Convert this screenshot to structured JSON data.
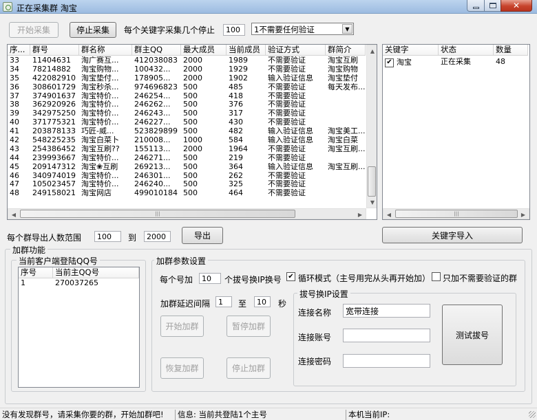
{
  "window": {
    "title": "正在采集群 淘宝"
  },
  "toolbar": {
    "start_collect": "开始采集",
    "stop_collect": "停止采集",
    "stop_after_label": "每个关键字采集几个停止",
    "stop_after_value": "100",
    "verify_select": "1不需要任何验证"
  },
  "groups_table": {
    "columns": [
      "序...",
      "群号",
      "群名称",
      "群主QQ",
      "最大成员",
      "当前成员",
      "验证方式",
      "群简介"
    ],
    "rows": [
      [
        "33",
        "11404631",
        "淘广赛互...",
        "412038083",
        "2000",
        "1989",
        "不需要验证",
        "淘宝互刷"
      ],
      [
        "34",
        "78214882",
        "淘宝购物...",
        "100432...",
        "2000",
        "1929",
        "不需要验证",
        "淘宝购物"
      ],
      [
        "35",
        "422082910",
        "淘宝垫付...",
        "178905...",
        "2000",
        "1902",
        "输入验证信息",
        "淘宝垫付"
      ],
      [
        "36",
        "308601729",
        "淘宝秒杀...",
        "974696823",
        "500",
        "485",
        "不需要验证",
        "每天发布..."
      ],
      [
        "37",
        "374901637",
        "淘宝特价...",
        "246254...",
        "500",
        "418",
        "不需要验证",
        ""
      ],
      [
        "38",
        "362920926",
        "淘宝特价...",
        "246262...",
        "500",
        "376",
        "不需要验证",
        ""
      ],
      [
        "39",
        "342975250",
        "淘宝特价...",
        "246243...",
        "500",
        "317",
        "不需要验证",
        ""
      ],
      [
        "40",
        "371775321",
        "淘宝特价...",
        "246227...",
        "500",
        "430",
        "不需要验证",
        ""
      ],
      [
        "41",
        "203878133",
        "巧匠-威...",
        "523829899",
        "500",
        "482",
        "输入验证信息",
        "淘宝美工..."
      ],
      [
        "42",
        "548225235",
        "淘宝白菜卜",
        "210008...",
        "1000",
        "584",
        "输入验证信息",
        "淘宝白菜"
      ],
      [
        "43",
        "254386452",
        "淘宝互刷??",
        "155113...",
        "2000",
        "1964",
        "不需要验证",
        "淘宝互刷..."
      ],
      [
        "44",
        "239993667",
        "淘宝特价...",
        "246271...",
        "500",
        "219",
        "不需要验证",
        ""
      ],
      [
        "45",
        "209147312",
        "淘宝❀互刷",
        "269213...",
        "500",
        "364",
        "输入验证信息",
        "淘宝互刷..."
      ],
      [
        "46",
        "340974019",
        "淘宝特价...",
        "246301...",
        "500",
        "262",
        "不需要验证",
        ""
      ],
      [
        "47",
        "105023457",
        "淘宝特价...",
        "246240...",
        "500",
        "325",
        "不需要验证",
        ""
      ],
      [
        "48",
        "249158021",
        "淘宝网店",
        "499010184",
        "500",
        "464",
        "不需要验证",
        ""
      ]
    ]
  },
  "keywords_table": {
    "columns": [
      "关键字",
      "状态",
      "数量"
    ],
    "rows": [
      {
        "keyword": "淘宝",
        "status": "正在采集",
        "count": "48",
        "checked": true
      }
    ]
  },
  "export": {
    "range_label": "每个群导出人数范围",
    "from_value": "100",
    "to_label": "到",
    "to_value": "2000",
    "export_button": "导出",
    "keyword_import_button": "关键字导入"
  },
  "join_section": {
    "title": "加群功能",
    "accounts_group_title": "当前客户端登陆QQ号",
    "accounts_columns": [
      "序号",
      "当前主QQ号"
    ],
    "accounts_rows": [
      [
        "1",
        "270037265"
      ]
    ]
  },
  "join_params": {
    "title": "加群参数设置",
    "per_number_label": "每个号加",
    "per_number_value": "10",
    "per_number_suffix": "个拔号换IP换号",
    "loop_mode_label": "循环模式（主号用完从头再开始加）",
    "loop_mode_checked": true,
    "only_no_verify_label": "只加不需要验证的群",
    "only_no_verify_checked": false,
    "delay_label": "加群延迟间隔",
    "delay_from": "1",
    "delay_to_label": "至",
    "delay_to": "10",
    "delay_unit": "秒",
    "start_join": "开始加群",
    "pause_join": "暂停加群",
    "resume_join": "恢复加群",
    "stop_join": "停止加群"
  },
  "dialup": {
    "title": "拔号换IP设置",
    "conn_name_label": "连接名称",
    "conn_name_value": "宽带连接",
    "account_label": "连接账号",
    "account_value": "",
    "password_label": "连接密码",
    "password_value": "",
    "test_button": "测试拔号"
  },
  "statusbar": {
    "left": "没有发现群号，请采集你要的群，开始加群吧!",
    "middle": "信息: 当前共登陆1个主号",
    "right": "本机当前IP:"
  }
}
